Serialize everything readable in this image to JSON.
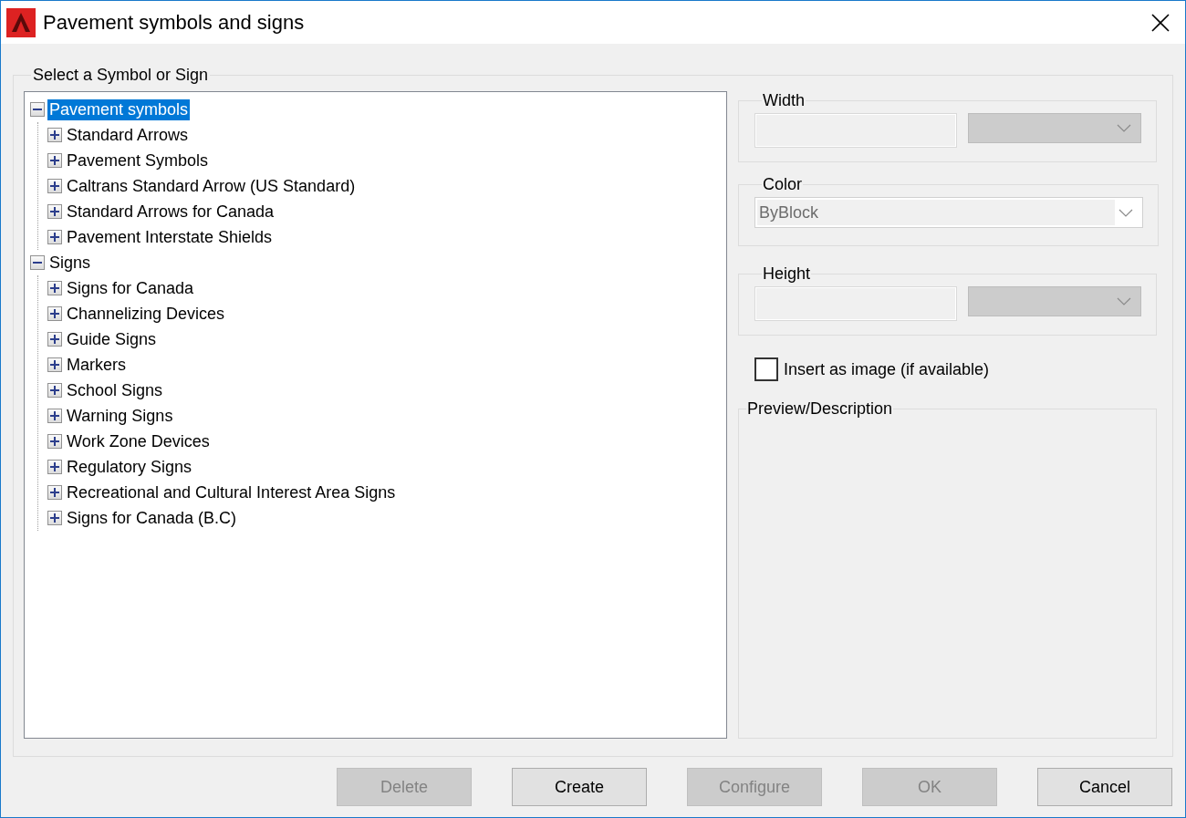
{
  "window": {
    "title": "Pavement symbols and signs"
  },
  "selector": {
    "label": "Select a Symbol or Sign",
    "tree": [
      {
        "label": "Pavement symbols",
        "expanded": true,
        "selected": true,
        "children": [
          {
            "label": "Standard Arrows",
            "expanded": false,
            "selected": false
          },
          {
            "label": "Pavement Symbols",
            "expanded": false,
            "selected": false
          },
          {
            "label": "Caltrans Standard Arrow (US Standard)",
            "expanded": false,
            "selected": false
          },
          {
            "label": "Standard Arrows for Canada",
            "expanded": false,
            "selected": false
          },
          {
            "label": "Pavement Interstate Shields",
            "expanded": false,
            "selected": false
          }
        ]
      },
      {
        "label": "Signs",
        "expanded": true,
        "selected": false,
        "children": [
          {
            "label": "Signs for Canada",
            "expanded": false,
            "selected": false
          },
          {
            "label": "Channelizing Devices",
            "expanded": false,
            "selected": false
          },
          {
            "label": "Guide Signs",
            "expanded": false,
            "selected": false
          },
          {
            "label": "Markers",
            "expanded": false,
            "selected": false
          },
          {
            "label": "School Signs",
            "expanded": false,
            "selected": false
          },
          {
            "label": "Warning Signs",
            "expanded": false,
            "selected": false
          },
          {
            "label": "Work Zone Devices",
            "expanded": false,
            "selected": false
          },
          {
            "label": "Regulatory Signs",
            "expanded": false,
            "selected": false
          },
          {
            "label": "Recreational and Cultural Interest Area Signs",
            "expanded": false,
            "selected": false
          },
          {
            "label": "Signs for Canada (B.C)",
            "expanded": false,
            "selected": false
          }
        ]
      }
    ]
  },
  "fields": [
    {
      "label": "Width",
      "kind": "split",
      "disabled": true
    },
    {
      "label": "Color",
      "kind": "combo",
      "value": "ByBlock",
      "disabled": true
    },
    {
      "label": "Height",
      "kind": "split",
      "disabled": true
    }
  ],
  "insert_as_image": {
    "label": "Insert as image (if available)",
    "checked": false
  },
  "preview": {
    "label": "Preview/Description"
  },
  "buttons": [
    {
      "label": "Delete",
      "disabled": true
    },
    {
      "label": "Create",
      "disabled": false
    },
    {
      "label": "Configure",
      "disabled": true
    },
    {
      "label": "OK",
      "disabled": true
    },
    {
      "label": "Cancel",
      "disabled": false
    }
  ]
}
